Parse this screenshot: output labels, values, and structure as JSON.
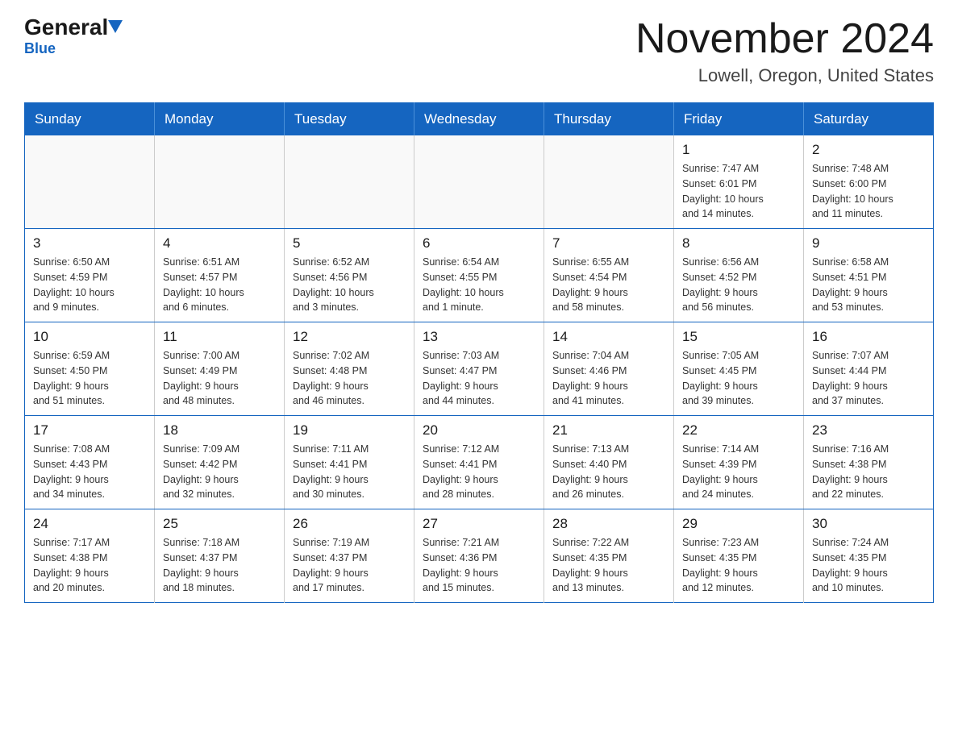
{
  "header": {
    "logo": {
      "general": "General",
      "blue": "Blue"
    },
    "title": "November 2024",
    "location": "Lowell, Oregon, United States"
  },
  "weekdays": [
    "Sunday",
    "Monday",
    "Tuesday",
    "Wednesday",
    "Thursday",
    "Friday",
    "Saturday"
  ],
  "weeks": [
    [
      {
        "day": "",
        "info": ""
      },
      {
        "day": "",
        "info": ""
      },
      {
        "day": "",
        "info": ""
      },
      {
        "day": "",
        "info": ""
      },
      {
        "day": "",
        "info": ""
      },
      {
        "day": "1",
        "info": "Sunrise: 7:47 AM\nSunset: 6:01 PM\nDaylight: 10 hours\nand 14 minutes."
      },
      {
        "day": "2",
        "info": "Sunrise: 7:48 AM\nSunset: 6:00 PM\nDaylight: 10 hours\nand 11 minutes."
      }
    ],
    [
      {
        "day": "3",
        "info": "Sunrise: 6:50 AM\nSunset: 4:59 PM\nDaylight: 10 hours\nand 9 minutes."
      },
      {
        "day": "4",
        "info": "Sunrise: 6:51 AM\nSunset: 4:57 PM\nDaylight: 10 hours\nand 6 minutes."
      },
      {
        "day": "5",
        "info": "Sunrise: 6:52 AM\nSunset: 4:56 PM\nDaylight: 10 hours\nand 3 minutes."
      },
      {
        "day": "6",
        "info": "Sunrise: 6:54 AM\nSunset: 4:55 PM\nDaylight: 10 hours\nand 1 minute."
      },
      {
        "day": "7",
        "info": "Sunrise: 6:55 AM\nSunset: 4:54 PM\nDaylight: 9 hours\nand 58 minutes."
      },
      {
        "day": "8",
        "info": "Sunrise: 6:56 AM\nSunset: 4:52 PM\nDaylight: 9 hours\nand 56 minutes."
      },
      {
        "day": "9",
        "info": "Sunrise: 6:58 AM\nSunset: 4:51 PM\nDaylight: 9 hours\nand 53 minutes."
      }
    ],
    [
      {
        "day": "10",
        "info": "Sunrise: 6:59 AM\nSunset: 4:50 PM\nDaylight: 9 hours\nand 51 minutes."
      },
      {
        "day": "11",
        "info": "Sunrise: 7:00 AM\nSunset: 4:49 PM\nDaylight: 9 hours\nand 48 minutes."
      },
      {
        "day": "12",
        "info": "Sunrise: 7:02 AM\nSunset: 4:48 PM\nDaylight: 9 hours\nand 46 minutes."
      },
      {
        "day": "13",
        "info": "Sunrise: 7:03 AM\nSunset: 4:47 PM\nDaylight: 9 hours\nand 44 minutes."
      },
      {
        "day": "14",
        "info": "Sunrise: 7:04 AM\nSunset: 4:46 PM\nDaylight: 9 hours\nand 41 minutes."
      },
      {
        "day": "15",
        "info": "Sunrise: 7:05 AM\nSunset: 4:45 PM\nDaylight: 9 hours\nand 39 minutes."
      },
      {
        "day": "16",
        "info": "Sunrise: 7:07 AM\nSunset: 4:44 PM\nDaylight: 9 hours\nand 37 minutes."
      }
    ],
    [
      {
        "day": "17",
        "info": "Sunrise: 7:08 AM\nSunset: 4:43 PM\nDaylight: 9 hours\nand 34 minutes."
      },
      {
        "day": "18",
        "info": "Sunrise: 7:09 AM\nSunset: 4:42 PM\nDaylight: 9 hours\nand 32 minutes."
      },
      {
        "day": "19",
        "info": "Sunrise: 7:11 AM\nSunset: 4:41 PM\nDaylight: 9 hours\nand 30 minutes."
      },
      {
        "day": "20",
        "info": "Sunrise: 7:12 AM\nSunset: 4:41 PM\nDaylight: 9 hours\nand 28 minutes."
      },
      {
        "day": "21",
        "info": "Sunrise: 7:13 AM\nSunset: 4:40 PM\nDaylight: 9 hours\nand 26 minutes."
      },
      {
        "day": "22",
        "info": "Sunrise: 7:14 AM\nSunset: 4:39 PM\nDaylight: 9 hours\nand 24 minutes."
      },
      {
        "day": "23",
        "info": "Sunrise: 7:16 AM\nSunset: 4:38 PM\nDaylight: 9 hours\nand 22 minutes."
      }
    ],
    [
      {
        "day": "24",
        "info": "Sunrise: 7:17 AM\nSunset: 4:38 PM\nDaylight: 9 hours\nand 20 minutes."
      },
      {
        "day": "25",
        "info": "Sunrise: 7:18 AM\nSunset: 4:37 PM\nDaylight: 9 hours\nand 18 minutes."
      },
      {
        "day": "26",
        "info": "Sunrise: 7:19 AM\nSunset: 4:37 PM\nDaylight: 9 hours\nand 17 minutes."
      },
      {
        "day": "27",
        "info": "Sunrise: 7:21 AM\nSunset: 4:36 PM\nDaylight: 9 hours\nand 15 minutes."
      },
      {
        "day": "28",
        "info": "Sunrise: 7:22 AM\nSunset: 4:35 PM\nDaylight: 9 hours\nand 13 minutes."
      },
      {
        "day": "29",
        "info": "Sunrise: 7:23 AM\nSunset: 4:35 PM\nDaylight: 9 hours\nand 12 minutes."
      },
      {
        "day": "30",
        "info": "Sunrise: 7:24 AM\nSunset: 4:35 PM\nDaylight: 9 hours\nand 10 minutes."
      }
    ]
  ]
}
